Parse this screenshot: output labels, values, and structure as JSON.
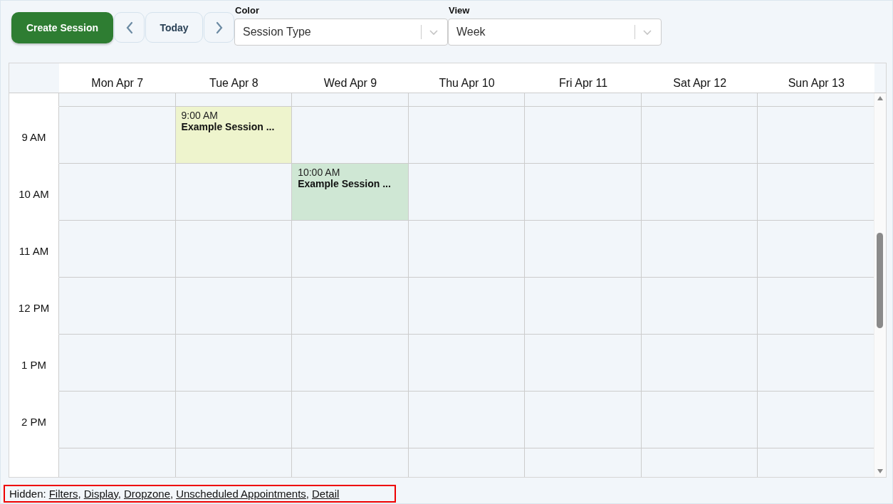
{
  "toolbar": {
    "create_button": "Create Session",
    "today_button": "Today"
  },
  "filters": [
    {
      "label": "Color",
      "value": "Session Type"
    },
    {
      "label": "View",
      "value": "Week"
    }
  ],
  "calendar": {
    "days": [
      "Mon Apr 7",
      "Tue Apr 8",
      "Wed Apr 9",
      "Thu Apr 10",
      "Fri Apr 11",
      "Sat Apr 12",
      "Sun Apr 13"
    ],
    "rows": [
      {
        "label": "9 AM",
        "cells": [
          null,
          {
            "time": "9:00 AM",
            "title": "Example Session ...",
            "color": "#eef4cd"
          },
          null,
          null,
          null,
          null,
          null
        ]
      },
      {
        "label": "10 AM",
        "cells": [
          null,
          null,
          {
            "time": "10:00 AM",
            "title": "Example Session ...",
            "color": "#cfe7d4"
          },
          null,
          null,
          null,
          null
        ]
      },
      {
        "label": "11 AM",
        "cells": [
          null,
          null,
          null,
          null,
          null,
          null,
          null
        ]
      },
      {
        "label": "12 PM",
        "cells": [
          null,
          null,
          null,
          null,
          null,
          null,
          null
        ]
      },
      {
        "label": "1 PM",
        "cells": [
          null,
          null,
          null,
          null,
          null,
          null,
          null
        ]
      },
      {
        "label": "2 PM",
        "cells": [
          null,
          null,
          null,
          null,
          null,
          null,
          null
        ]
      }
    ]
  },
  "footer": {
    "label": "Hidden:",
    "links": [
      {
        "text": "Filters",
        "separator": ","
      },
      {
        "text": "Display",
        "separator": ","
      },
      {
        "text": "Dropzone",
        "separator": ","
      },
      {
        "text": "Unscheduled Appointments",
        "separator": ","
      },
      {
        "text": "Detail"
      }
    ]
  }
}
